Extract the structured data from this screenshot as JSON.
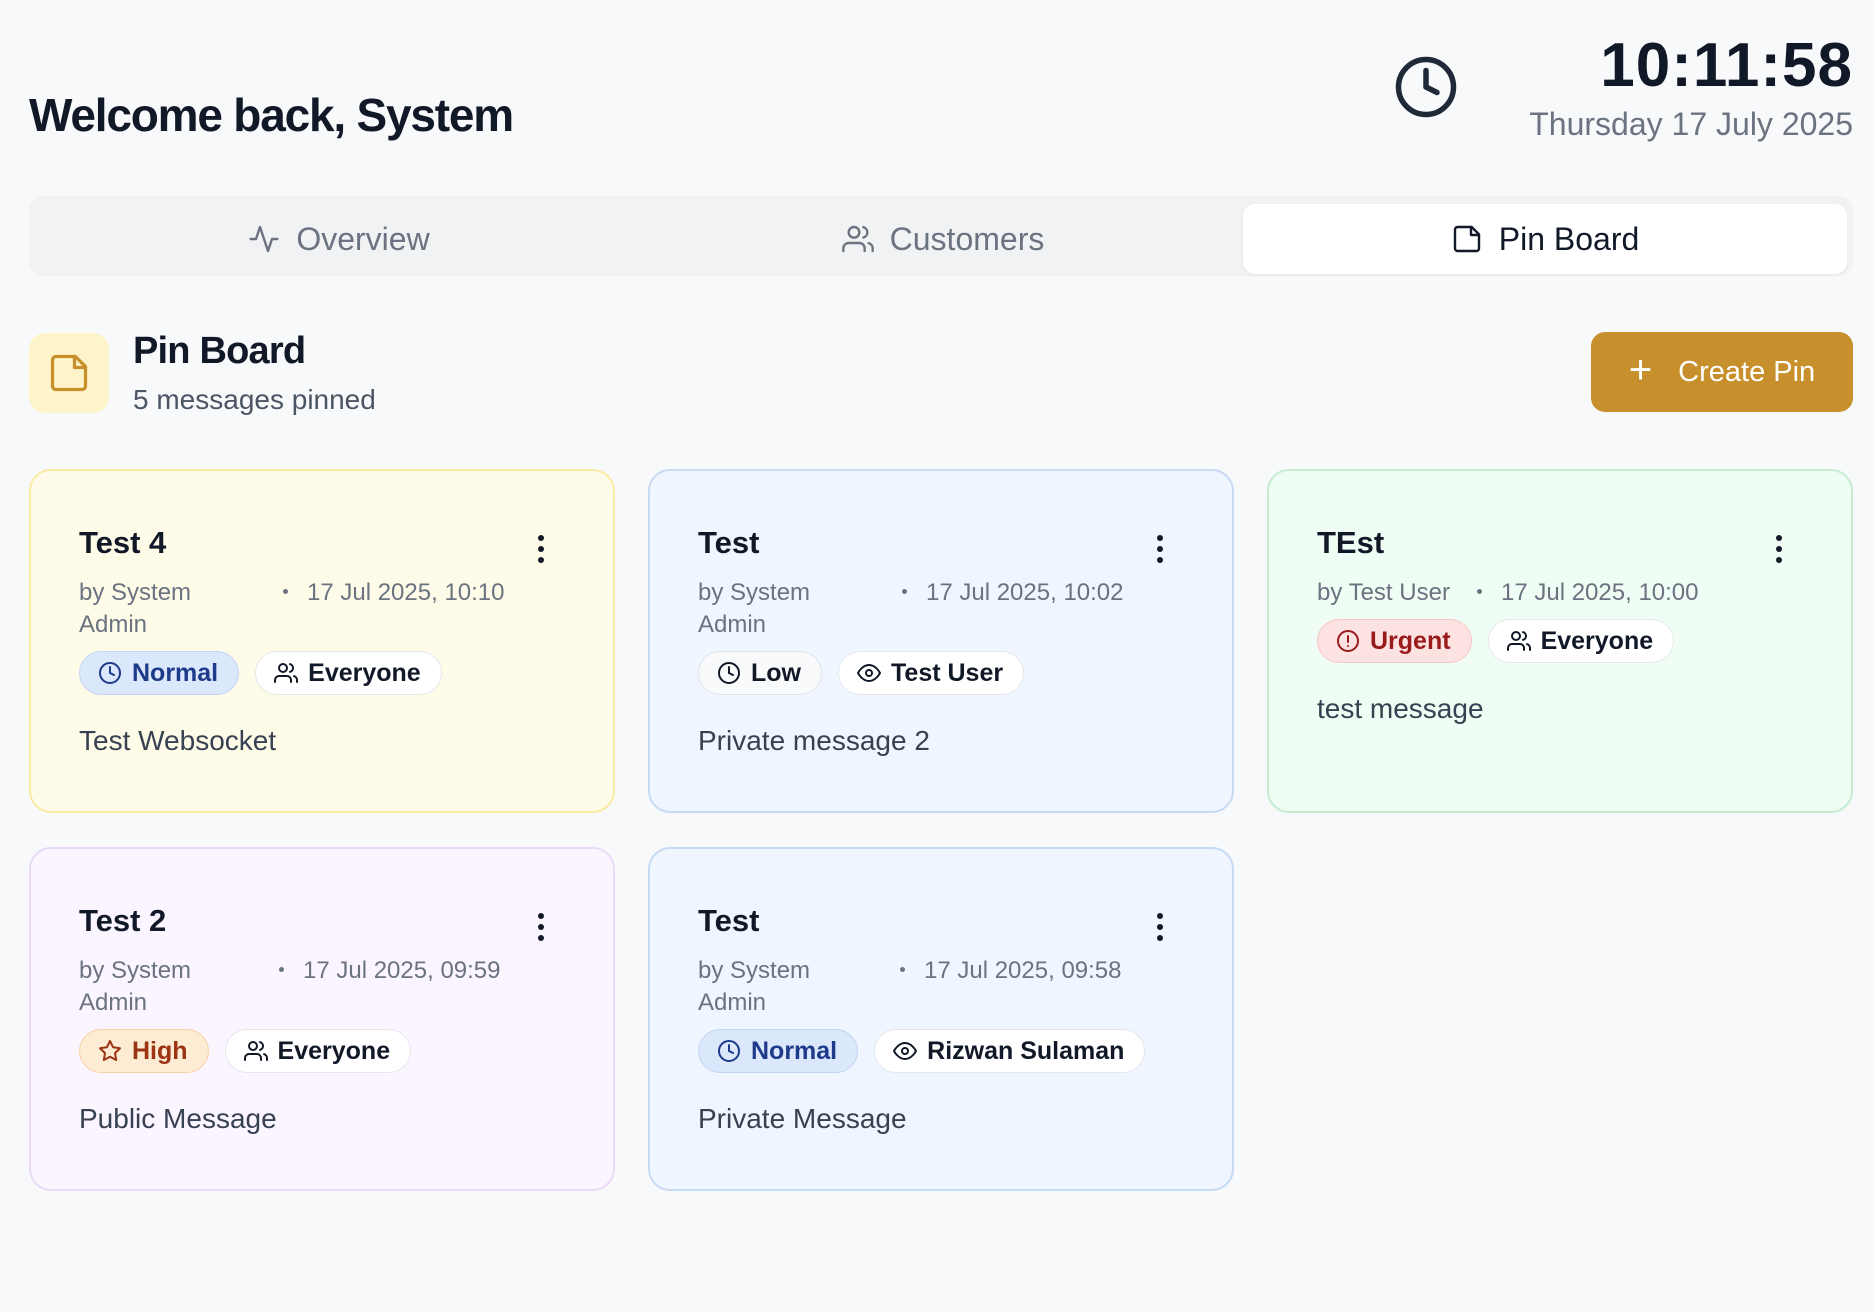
{
  "header": {
    "welcome": "Welcome back, System",
    "time": "10:11:58",
    "date": "Thursday 17 July 2025"
  },
  "tabs": [
    {
      "label": "Overview",
      "icon": "activity-icon",
      "active": false
    },
    {
      "label": "Customers",
      "icon": "users-icon",
      "active": false
    },
    {
      "label": "Pin Board",
      "icon": "sticky-note-icon",
      "active": true
    }
  ],
  "section": {
    "title": "Pin Board",
    "subtitle": "5 messages pinned",
    "create_label": "Create Pin",
    "accent": "#c8902c"
  },
  "pins": [
    {
      "title": "Test 4",
      "author": "by System Admin",
      "when": "17 Jul 2025, 10:10",
      "priority": "Normal",
      "priority_icon": "clock-icon",
      "audience": "Everyone",
      "audience_icon": "users-icon",
      "message": "Test Websocket",
      "color": "yellow"
    },
    {
      "title": "Test",
      "author": "by System Admin",
      "when": "17 Jul 2025, 10:02",
      "priority": "Low",
      "priority_icon": "clock-icon",
      "audience": "Test User",
      "audience_icon": "eye-icon",
      "message": "Private message 2",
      "color": "blue"
    },
    {
      "title": "TEst",
      "author": "by Test User",
      "when": "17 Jul 2025, 10:00",
      "priority": "Urgent",
      "priority_icon": "alert-circle-icon",
      "audience": "Everyone",
      "audience_icon": "users-icon",
      "message": "test message",
      "color": "green"
    },
    {
      "title": "Test 2",
      "author": "by System Admin",
      "when": "17 Jul 2025, 09:59",
      "priority": "High",
      "priority_icon": "star-icon",
      "audience": "Everyone",
      "audience_icon": "users-icon",
      "message": "Public Message",
      "color": "purple"
    },
    {
      "title": "Test",
      "author": "by System Admin",
      "when": "17 Jul 2025, 09:58",
      "priority": "Normal",
      "priority_icon": "clock-icon",
      "audience": "Rizwan Sulaman",
      "audience_icon": "eye-icon",
      "message": "Private Message",
      "color": "blue"
    }
  ]
}
